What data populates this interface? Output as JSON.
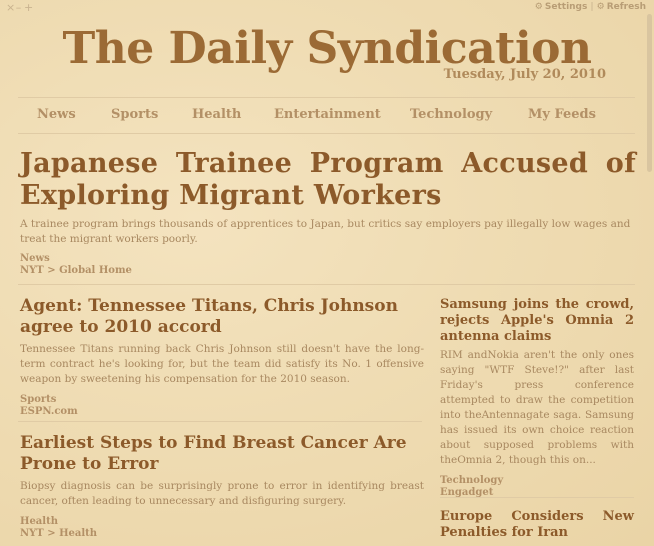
{
  "window": {
    "controls": [
      "×",
      "–",
      "+"
    ]
  },
  "topbar": {
    "settings_label": "Settings",
    "refresh_label": "Refresh",
    "settings_icon": "⚙",
    "refresh_icon": "⚙"
  },
  "masthead": {
    "title": "The Daily Syndication",
    "date": "Tuesday, July 20, 2010"
  },
  "nav": {
    "items": [
      "News",
      "Sports",
      "Health",
      "Entertainment",
      "Technology",
      "My Feeds"
    ]
  },
  "lead": {
    "headline": "Japanese Trainee Program Accused of Exploring Migrant Workers",
    "summary": "A trainee program brings thousands of apprentices to Japan, but critics say employers pay illegally low wages and treat the migrant workers poorly.",
    "category": "News",
    "source": "NYT > Global Home"
  },
  "left_articles": [
    {
      "headline": "Agent: Tennessee Titans, Chris Johnson agree to 2010 accord",
      "summary": "Tennessee Titans running back Chris Johnson still doesn't have the long-term contract he's looking for, but the team did satisfy its No. 1 offensive weapon by sweetening his compensation for the 2010 season.",
      "category": "Sports",
      "source": "ESPN.com"
    },
    {
      "headline": "Earliest Steps to Find Breast Cancer Are Prone to Error",
      "summary": "Biopsy diagnosis can be surprisingly prone to error in identifying breast cancer, often leading to unnecessary and disfiguring surgery.",
      "category": "Health",
      "source": "NYT > Health"
    }
  ],
  "right_articles": [
    {
      "headline": "Samsung joins the crowd, rejects Apple's Omnia 2 antenna claims",
      "summary": "RIM andNokia aren't the only ones saying \"WTF Steve!?\" after last Friday's press conference attempted to draw the competition into theAntennagate saga. Samsung has issued its own choice reaction about supposed problems with theOmnia 2, though this on...",
      "category": "Technology",
      "source": "Engadget"
    },
    {
      "headline": "Europe Considers New Penalties for Iran",
      "summary": "",
      "category": "",
      "source": ""
    }
  ],
  "colors": {
    "background": "#efdcb3",
    "headline": "#8c5a2a",
    "masthead": "#9b6a35",
    "muted": "#b39066"
  }
}
